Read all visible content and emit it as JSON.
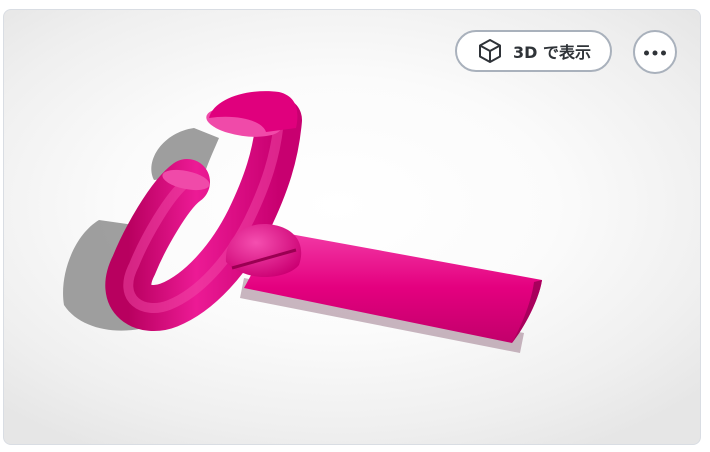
{
  "viewer": {
    "view_3d_label": "3D で表示",
    "view_3d_icon": "cube-icon",
    "more_icon": "more-horizontal-icon",
    "model_color": "#e6008a"
  }
}
